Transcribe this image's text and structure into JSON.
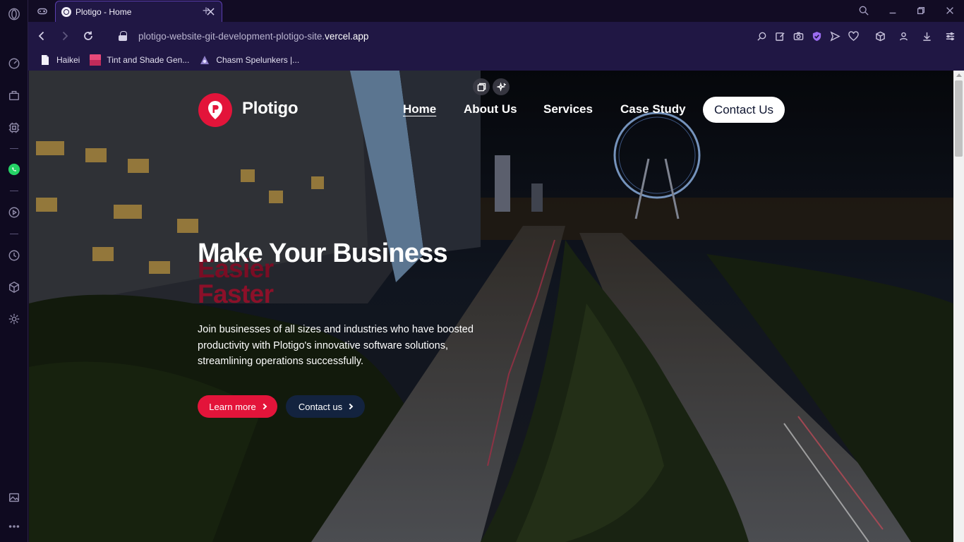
{
  "browser": {
    "tab": {
      "title": "Plotigo - Home"
    },
    "url": {
      "prefix": "plotigo-website-git-development-plotigo-site.",
      "domain": "vercel.app"
    },
    "bookmarks": [
      {
        "label": "Haikei"
      },
      {
        "label": "Tint and Shade Gen..."
      },
      {
        "label": "Chasm Spelunkers |..."
      }
    ]
  },
  "site": {
    "logo": "Plotigo",
    "nav": [
      {
        "label": "Home",
        "active": true
      },
      {
        "label": "About Us",
        "active": false
      },
      {
        "label": "Services",
        "active": false
      },
      {
        "label": "Case Study",
        "active": false
      }
    ],
    "contact_button": "Contact Us",
    "hero": {
      "title": "Make Your Business",
      "rotating_words": [
        "Easier",
        "Faster"
      ],
      "description": "Join businesses of all sizes and industries who have boosted productivity with Plotigo's innovative software solutions, streamlining operations successfully.",
      "primary_button": "Learn more",
      "secondary_button": "Contact us"
    }
  },
  "colors": {
    "brand_red": "#e3143a",
    "navy": "#13233f",
    "browser_bg": "#201744"
  }
}
